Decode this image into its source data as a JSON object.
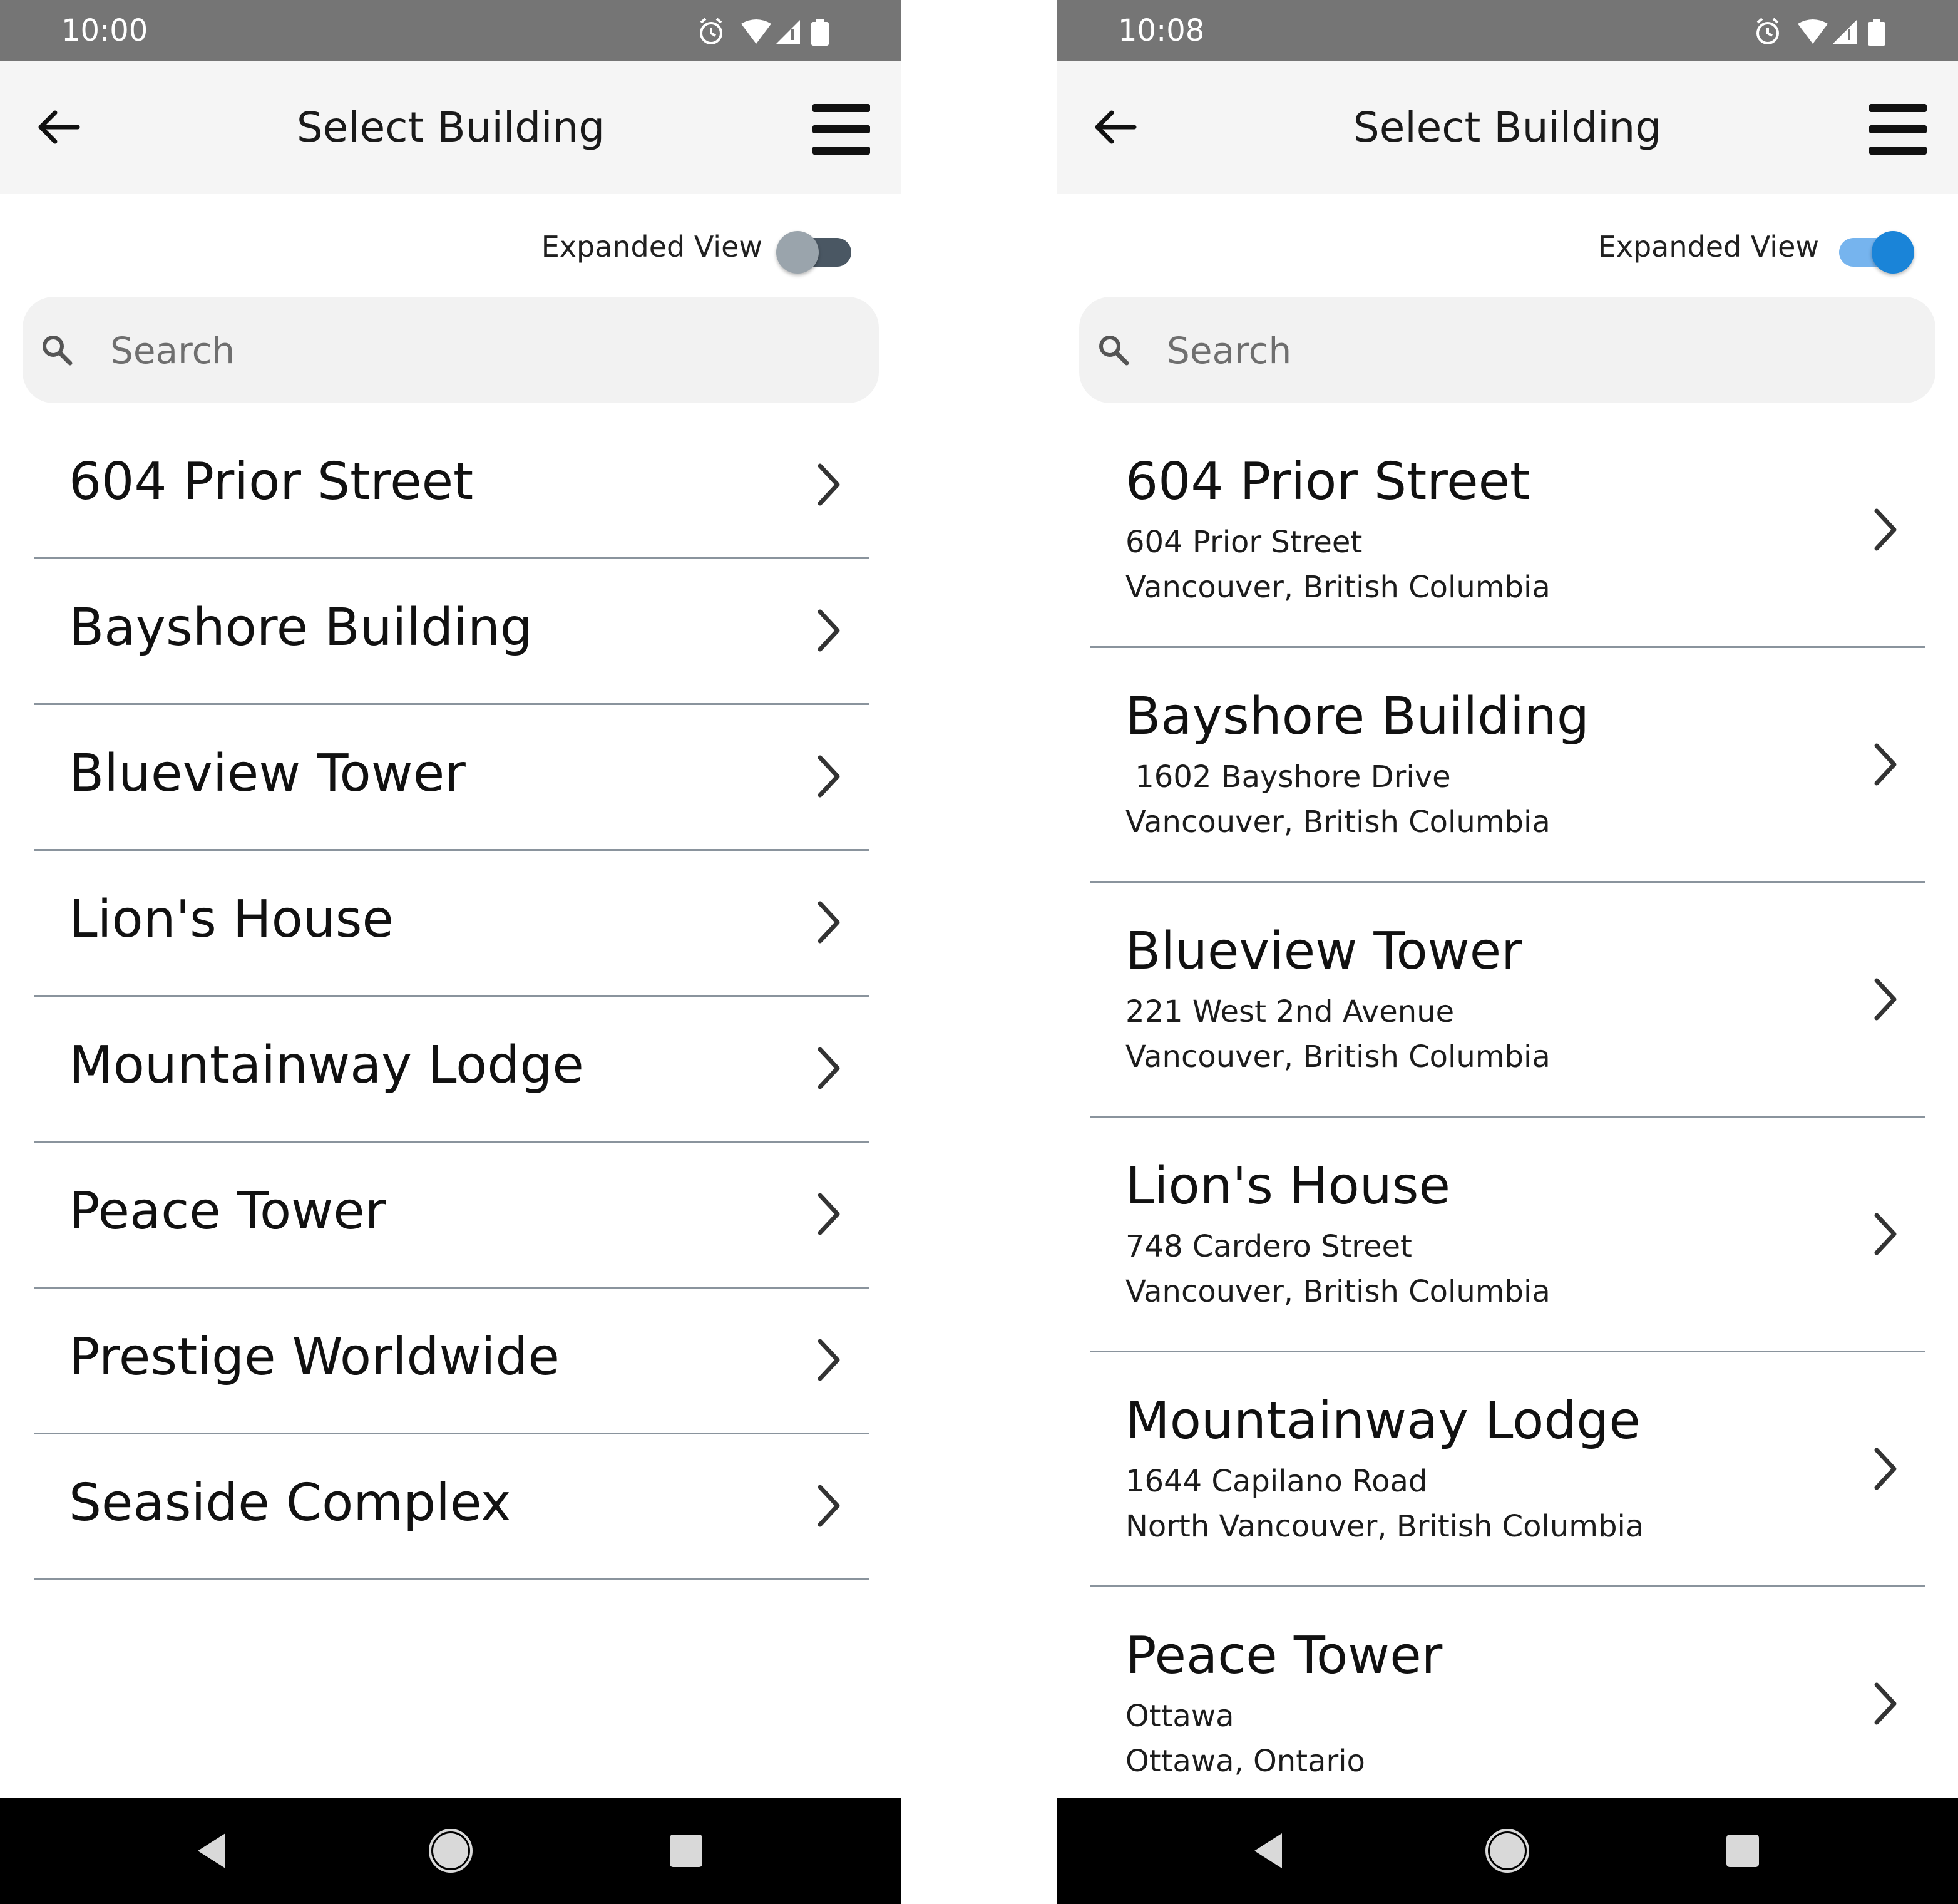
{
  "colors": {
    "status_bar": "#757575",
    "app_bar": "#f5f5f5",
    "divider": "#8a949d",
    "toggle_off_track": "#4a5763",
    "toggle_off_thumb": "#9aa4ac",
    "toggle_on_track": "#76b4ee",
    "toggle_on_thumb": "#1a84d8",
    "nav_bar": "#000000"
  },
  "screens": [
    {
      "status": {
        "time": "10:00"
      },
      "app_bar": {
        "title": "Select Building",
        "back_icon": "arrow-left-icon",
        "menu_icon": "hamburger-menu-icon"
      },
      "toggle": {
        "label": "Expanded View",
        "on": false
      },
      "search": {
        "placeholder": "Search"
      },
      "buildings": [
        {
          "name": "604 Prior Street"
        },
        {
          "name": "Bayshore Building"
        },
        {
          "name": "Blueview Tower"
        },
        {
          "name": "Lion's House"
        },
        {
          "name": "Mountainway Lodge"
        },
        {
          "name": "Peace Tower"
        },
        {
          "name": "Prestige Worldwide"
        },
        {
          "name": "Seaside Complex"
        }
      ]
    },
    {
      "status": {
        "time": "10:08"
      },
      "app_bar": {
        "title": "Select Building",
        "back_icon": "arrow-left-icon",
        "menu_icon": "hamburger-menu-icon"
      },
      "toggle": {
        "label": "Expanded View",
        "on": true
      },
      "search": {
        "placeholder": "Search"
      },
      "buildings": [
        {
          "name": "604 Prior Street",
          "address": "604 Prior Street",
          "city": "Vancouver, British Columbia"
        },
        {
          "name": "Bayshore Building",
          "address": " 1602 Bayshore Drive",
          "city": "Vancouver, British Columbia"
        },
        {
          "name": "Blueview Tower",
          "address": "221 West 2nd Avenue",
          "city": "Vancouver, British Columbia"
        },
        {
          "name": "Lion's House",
          "address": "748 Cardero Street",
          "city": "Vancouver, British Columbia"
        },
        {
          "name": "Mountainway Lodge",
          "address": "1644 Capilano Road",
          "city": "North Vancouver, British Columbia"
        },
        {
          "name": "Peace Tower",
          "address": "Ottawa",
          "city": "Ottawa, Ontario"
        }
      ]
    }
  ]
}
